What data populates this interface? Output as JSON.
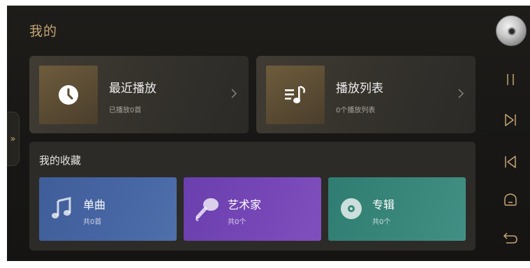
{
  "header": {
    "title": "我的"
  },
  "drawer": {
    "toggle_glyph": "»"
  },
  "cards": {
    "recent": {
      "title": "最近播放",
      "subtitle": "已播放0首",
      "icon": "clock-icon"
    },
    "playlist": {
      "title": "播放列表",
      "subtitle": "0个播放列表",
      "icon": "playlist-icon"
    }
  },
  "favorites": {
    "title": "我的收藏",
    "tiles": [
      {
        "label": "单曲",
        "sub": "共0首",
        "icon": "music-note-icon",
        "color": "#4766a4"
      },
      {
        "label": "艺术家",
        "sub": "共0个",
        "icon": "microphone-icon",
        "color": "#7747b7"
      },
      {
        "label": "专辑",
        "sub": "共0个",
        "icon": "disc-icon",
        "color": "#3a877b"
      }
    ]
  },
  "rail": {
    "buttons": [
      "now-playing-disc",
      "pause-icon",
      "next-icon",
      "previous-icon",
      "home-icon",
      "back-icon"
    ]
  },
  "colors": {
    "accent": "#c5a574",
    "background": "#1b1a18"
  }
}
